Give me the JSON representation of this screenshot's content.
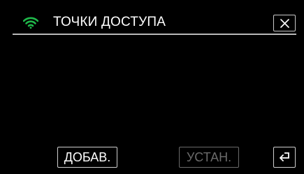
{
  "header": {
    "title": "ТОЧКИ ДОСТУПА",
    "wifi_icon": "wifi-icon",
    "close_icon": "close-icon"
  },
  "footer": {
    "add_label": "ДОБАВ.",
    "set_label": "УСТАН.",
    "back_icon": "return-arrow-icon"
  },
  "colors": {
    "background": "#000000",
    "text": "#ffffff",
    "wifi": "#1fb84a",
    "disabled": "#6a6a6a",
    "border": "#cfcfcf"
  }
}
